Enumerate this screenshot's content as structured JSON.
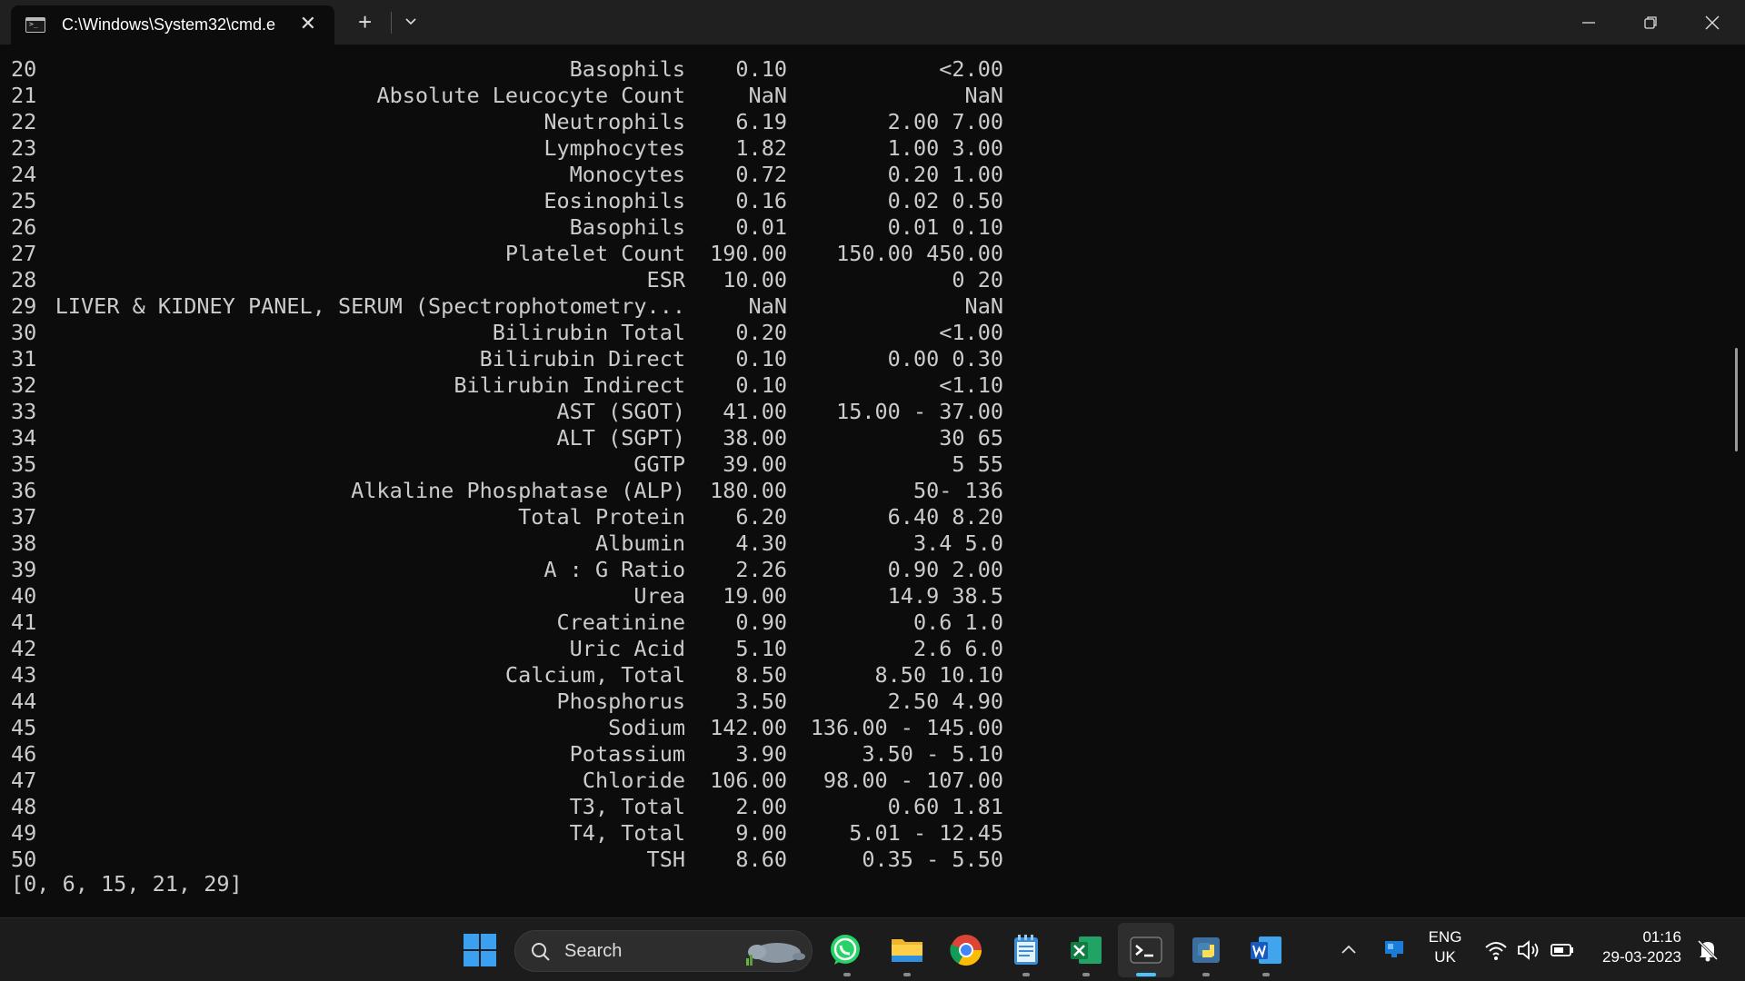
{
  "window": {
    "tab_title": "C:\\Windows\\System32\\cmd.e"
  },
  "terminal": {
    "rows": [
      {
        "idx": "20",
        "name": "Basophils",
        "value": "0.10",
        "range": "<2.00"
      },
      {
        "idx": "21",
        "name": "Absolute Leucocyte Count",
        "value": "NaN",
        "range": "NaN"
      },
      {
        "idx": "22",
        "name": "Neutrophils",
        "value": "6.19",
        "range": "2.00 7.00"
      },
      {
        "idx": "23",
        "name": "Lymphocytes",
        "value": "1.82",
        "range": "1.00 3.00"
      },
      {
        "idx": "24",
        "name": "Monocytes",
        "value": "0.72",
        "range": "0.20 1.00"
      },
      {
        "idx": "25",
        "name": "Eosinophils",
        "value": "0.16",
        "range": "0.02 0.50"
      },
      {
        "idx": "26",
        "name": "Basophils",
        "value": "0.01",
        "range": "0.01 0.10"
      },
      {
        "idx": "27",
        "name": "Platelet Count",
        "value": "190.00",
        "range": "150.00 450.00"
      },
      {
        "idx": "28",
        "name": "ESR",
        "value": "10.00",
        "range": "0 20"
      },
      {
        "idx": "29",
        "name": "LIVER & KIDNEY PANEL, SERUM (Spectrophotometry...",
        "value": "NaN",
        "range": "NaN"
      },
      {
        "idx": "30",
        "name": "Bilirubin Total",
        "value": "0.20",
        "range": "<1.00"
      },
      {
        "idx": "31",
        "name": "Bilirubin Direct",
        "value": "0.10",
        "range": "0.00 0.30"
      },
      {
        "idx": "32",
        "name": "Bilirubin Indirect",
        "value": "0.10",
        "range": "<1.10"
      },
      {
        "idx": "33",
        "name": "AST (SGOT)",
        "value": "41.00",
        "range": "15.00 - 37.00"
      },
      {
        "idx": "34",
        "name": "ALT (SGPT)",
        "value": "38.00",
        "range": "30 65"
      },
      {
        "idx": "35",
        "name": "GGTP",
        "value": "39.00",
        "range": "5 55"
      },
      {
        "idx": "36",
        "name": "Alkaline Phosphatase (ALP)",
        "value": "180.00",
        "range": "50- 136"
      },
      {
        "idx": "37",
        "name": "Total Protein",
        "value": "6.20",
        "range": "6.40 8.20"
      },
      {
        "idx": "38",
        "name": "Albumin",
        "value": "4.30",
        "range": "3.4 5.0"
      },
      {
        "idx": "39",
        "name": "A : G Ratio",
        "value": "2.26",
        "range": "0.90 2.00"
      },
      {
        "idx": "40",
        "name": "Urea",
        "value": "19.00",
        "range": "14.9 38.5"
      },
      {
        "idx": "41",
        "name": "Creatinine",
        "value": "0.90",
        "range": "0.6 1.0"
      },
      {
        "idx": "42",
        "name": "Uric Acid",
        "value": "5.10",
        "range": "2.6 6.0"
      },
      {
        "idx": "43",
        "name": "Calcium, Total",
        "value": "8.50",
        "range": "8.50 10.10"
      },
      {
        "idx": "44",
        "name": "Phosphorus",
        "value": "3.50",
        "range": "2.50 4.90"
      },
      {
        "idx": "45",
        "name": "Sodium",
        "value": "142.00",
        "range": "136.00 - 145.00"
      },
      {
        "idx": "46",
        "name": "Potassium",
        "value": "3.90",
        "range": "3.50 - 5.10"
      },
      {
        "idx": "47",
        "name": "Chloride",
        "value": "106.00",
        "range": "98.00 - 107.00"
      },
      {
        "idx": "48",
        "name": "T3, Total",
        "value": "2.00",
        "range": "0.60 1.81"
      },
      {
        "idx": "49",
        "name": "T4, Total",
        "value": "9.00",
        "range": "5.01 - 12.45"
      },
      {
        "idx": "50",
        "name": "TSH",
        "value": "8.60",
        "range": "0.35 - 5.50"
      }
    ],
    "output_line": "[0, 6, 15, 21, 29]"
  },
  "taskbar": {
    "search_label": "Search",
    "apps": [
      "whatsapp-icon",
      "file-explorer-icon",
      "chrome-icon",
      "notepad-icon",
      "excel-icon",
      "terminal-icon",
      "python-icon",
      "word-icon"
    ],
    "language_line1": "ENG",
    "language_line2": "UK",
    "time": "01:16",
    "date": "29-03-2023"
  },
  "colors": {
    "terminal_bg": "#0c0c0c",
    "terminal_fg": "#cccccc",
    "titlebar_bg": "#202020",
    "taskbar_bg": "#1c1c1c",
    "accent": "#4cc2ff"
  }
}
